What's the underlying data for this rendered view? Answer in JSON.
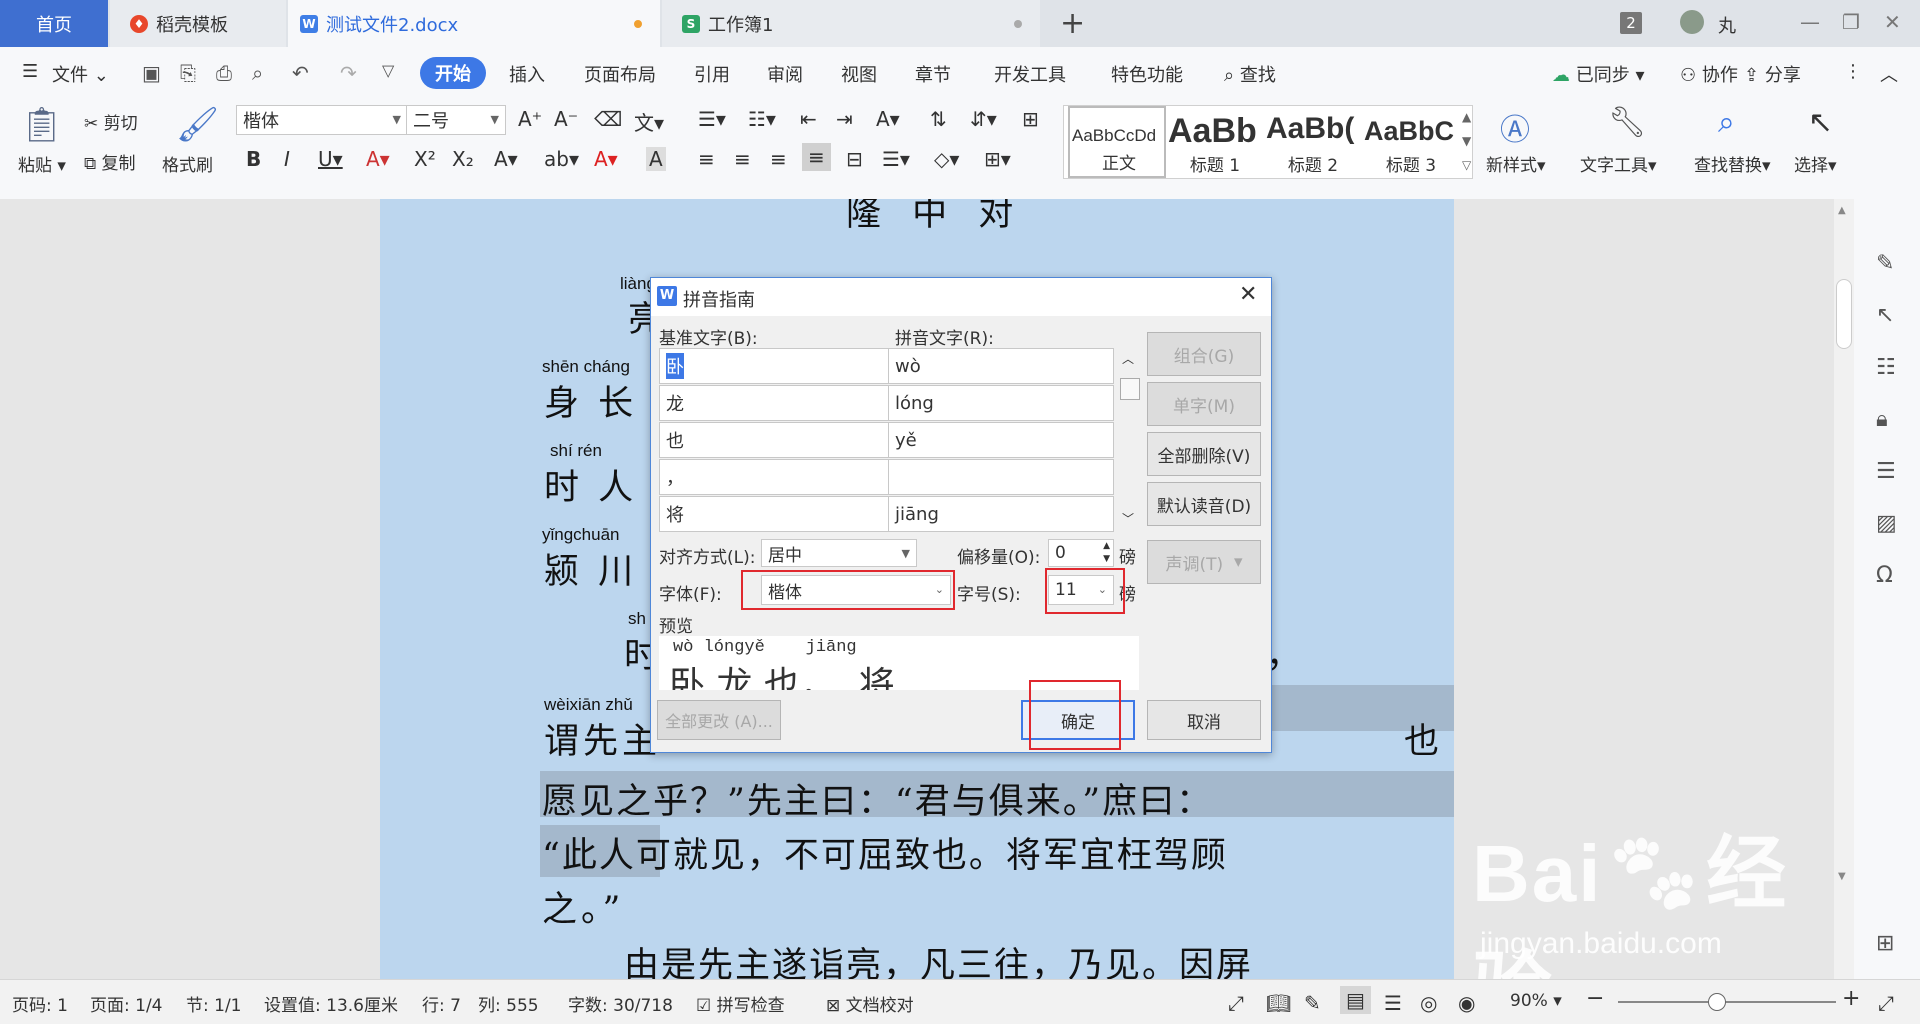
{
  "tabs": {
    "home": "首页",
    "daoke": "稻壳模板",
    "doc": "测试文件2.docx",
    "book": "工作簿1",
    "count": "2",
    "user": "丸"
  },
  "menu": {
    "file": "文件",
    "items": [
      "开始",
      "插入",
      "页面布局",
      "引用",
      "审阅",
      "视图",
      "章节",
      "开发工具",
      "特色功能",
      "查找"
    ],
    "synced": "已同步",
    "collab": "协作",
    "share": "分享"
  },
  "ribbon": {
    "paste": "粘贴",
    "cut": "剪切",
    "copy": "复制",
    "format_painter": "格式刷",
    "font_name": "楷体",
    "font_size": "二号",
    "styles": [
      {
        "preview": "AaBbCcDd",
        "label": "正文"
      },
      {
        "preview": "AaBb",
        "label": "标题 1"
      },
      {
        "preview": "AaBb(",
        "label": "标题 2"
      },
      {
        "preview": "AaBbC",
        "label": "标题 3"
      }
    ],
    "new_style": "新样式",
    "text_tools": "文字工具",
    "find_replace": "查找替换",
    "select": "选择"
  },
  "document": {
    "title": "隆 中 对",
    "lines": [
      {
        "py": "liàng",
        "text": "亮"
      },
      {
        "py": "shēn cháng",
        "text": "身 长"
      },
      {
        "py": "shí   rén",
        "text": "时 人"
      },
      {
        "py": "yǐngchuān",
        "text": "颍 川"
      },
      {
        "py": "sh",
        "text": "时"
      },
      {
        "py": "wèixiān zhǔ",
        "text": "谓先主"
      },
      {
        "py": "",
        "text": "愿见之乎？”先主曰：“君与俱来。”庶曰："
      },
      {
        "py": "",
        "text": "“此人可就见，不可屈致也。将军宜枉驾顾"
      },
      {
        "py": "",
        "text": "之。”"
      },
      {
        "py": "",
        "text": "由是先主遂诣亮，凡三往，乃见。因屏"
      }
    ],
    "side_chars": [
      "，",
      "也"
    ]
  },
  "dialog": {
    "title": "拼音指南",
    "base_label": "基准文字(B):",
    "ruby_label": "拼音文字(R):",
    "rows": [
      {
        "base": "卧",
        "ruby": "wò"
      },
      {
        "base": "龙",
        "ruby": "lóng"
      },
      {
        "base": "也",
        "ruby": "yě"
      },
      {
        "base": "，",
        "ruby": ""
      },
      {
        "base": "将",
        "ruby": "jiāng"
      }
    ],
    "buttons": {
      "group": "组合(G)",
      "single": "单字(M)",
      "delete_all": "全部删除(V)",
      "default": "默认读音(D)",
      "tone": "声调(T)",
      "change_all": "全部更改 (A)...",
      "ok": "确定",
      "cancel": "取消"
    },
    "align_label": "对齐方式(L):",
    "align_value": "居中",
    "offset_label": "偏移量(O):",
    "offset_value": "0",
    "unit": "磅",
    "font_label": "字体(F):",
    "font_value": "楷体",
    "size_label": "字号(S):",
    "size_value": "11",
    "preview_label": "预览",
    "preview_py": "wò lóngyě    jiāng",
    "preview_text": "卧 龙 也，  将"
  },
  "status": {
    "page_code": "页码: 1",
    "page": "页面: 1/4",
    "section": "节: 1/1",
    "setting": "设置值: 13.6厘米",
    "row": "行: 7",
    "col": "列: 555",
    "words": "字数: 30/718",
    "spell": "拼写检查",
    "proof": "文档校对",
    "zoom": "90%"
  },
  "watermark": {
    "brand": "Bai",
    "brand2": "经验",
    "url": "jingyan.baidu.com"
  },
  "colors": {
    "accent": "#3d78e6",
    "highlight_box": "#e0282e",
    "page": "#bcd6ee"
  }
}
